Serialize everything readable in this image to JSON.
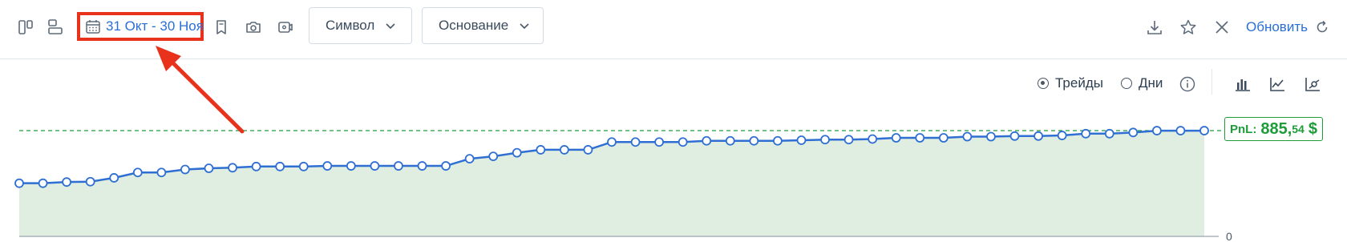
{
  "toolbar": {
    "date_range": "31 Окт - 30 Ноя",
    "dropdown_symbol": "Символ",
    "dropdown_basis": "Основание",
    "refresh_label": "Обновить",
    "icons": [
      "layout-columns-icon",
      "layout-rows-icon",
      "calendar-icon",
      "bookmark-icon",
      "camera-icon",
      "video-icon",
      "download-icon",
      "star-icon",
      "close-icon",
      "refresh-icon"
    ]
  },
  "view": {
    "trades_label": "Трейды",
    "days_label": "Дни",
    "selected": "Трейды",
    "icons": [
      "info-icon",
      "bar-chart-icon",
      "line-chart-icon",
      "scatter-chart-icon"
    ]
  },
  "pnl": {
    "label": "PnL:",
    "int_part": "885,",
    "dec_part": "54",
    "currency": "$"
  },
  "colors": {
    "accent": "#2a6fd6",
    "line": "#2f6fd3",
    "area": "#dfeee0",
    "pnl": "#1e9c3a",
    "annotation": "#e8321c"
  },
  "chart_data": {
    "type": "area",
    "y_zero_label": "0",
    "ylim": [
      0,
      885.54
    ],
    "reference_line": 885.54,
    "x": [
      1,
      2,
      3,
      4,
      5,
      6,
      7,
      8,
      9,
      10,
      11,
      12,
      13,
      14,
      15,
      16,
      17,
      18,
      19,
      20,
      21,
      22,
      23,
      24,
      25,
      26,
      27,
      28,
      29,
      30,
      31,
      32,
      33,
      34,
      35,
      36,
      37,
      38,
      39,
      40,
      41,
      42,
      43,
      44,
      45,
      46,
      47,
      48,
      49,
      50,
      51
    ],
    "values": [
      445,
      445,
      455,
      458,
      490,
      535,
      535,
      560,
      570,
      575,
      585,
      585,
      585,
      590,
      590,
      590,
      590,
      590,
      590,
      650,
      670,
      700,
      725,
      725,
      725,
      790,
      790,
      790,
      790,
      800,
      800,
      800,
      800,
      805,
      810,
      810,
      815,
      825,
      825,
      825,
      835,
      835,
      840,
      840,
      845,
      860,
      860,
      870,
      885,
      885,
      885
    ]
  }
}
